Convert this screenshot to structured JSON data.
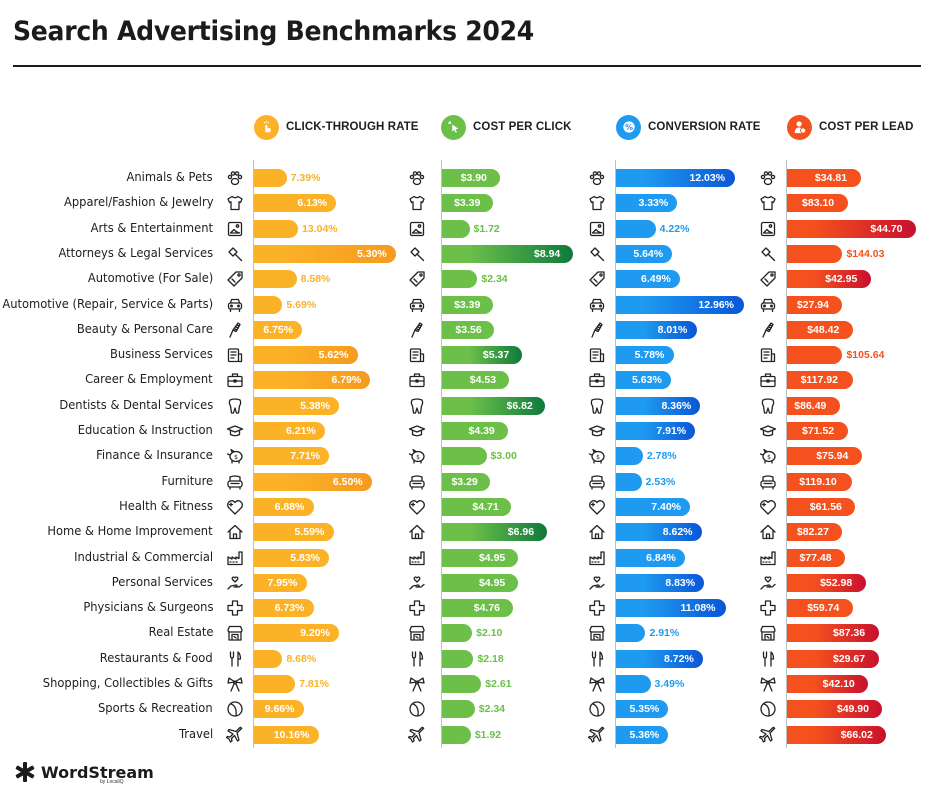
{
  "chart_data": {
    "type": "bar",
    "title": "Search Advertising Benchmarks 2024",
    "orientation": "horizontal",
    "categories": [
      "Animals & Pets",
      "Apparel/Fashion & Jewelry",
      "Arts & Entertainment",
      "Attorneys & Legal Services",
      "Automotive (For Sale)",
      "Automotive (Repair, Service & Parts)",
      "Beauty & Personal Care",
      "Business Services",
      "Career & Employment",
      "Dentists & Dental Services",
      "Education & Instruction",
      "Finance & Insurance",
      "Furniture",
      "Health & Fitness",
      "Home & Home Improvement",
      "Industrial & Commercial",
      "Personal Services",
      "Physicians & Surgeons",
      "Real Estate",
      "Restaurants & Food",
      "Shopping, Collectibles & Gifts",
      "Sports & Recreation",
      "Travel"
    ],
    "category_icons": [
      "paw-icon",
      "tshirt-icon",
      "picture-icon",
      "gavel-icon",
      "price-tag-icon",
      "car-icon",
      "comb-icon",
      "newspaper-icon",
      "briefcase-icon",
      "tooth-icon",
      "graduation-cap-icon",
      "piggy-bank-icon",
      "armchair-icon",
      "heart-icon",
      "house-icon",
      "factory-icon",
      "hand-heart-icon",
      "medical-cross-icon",
      "storefront-icon",
      "fork-knife-icon",
      "bow-icon",
      "ball-icon",
      "airplane-icon"
    ],
    "series": [
      {
        "name": "CLICK-THROUGH RATE",
        "icon": "tap-hand-icon",
        "color": "#FBB227",
        "color_end": "#F59A1F",
        "labels": [
          "7.39%",
          "6.13%",
          "13.04%",
          "5.30%",
          "8.58%",
          "5.69%",
          "6.75%",
          "5.62%",
          "6.79%",
          "5.38%",
          "6.21%",
          "7.71%",
          "6.50%",
          "6.88%",
          "5.59%",
          "5.83%",
          "7.95%",
          "6.73%",
          "9.20%",
          "8.68%",
          "7.81%",
          "9.66%",
          "10.16%"
        ],
        "values": [
          7.39,
          6.13,
          13.04,
          5.3,
          8.58,
          5.69,
          6.75,
          5.62,
          6.79,
          5.38,
          6.21,
          7.71,
          6.5,
          6.88,
          5.59,
          5.83,
          7.95,
          6.73,
          9.2,
          8.68,
          7.81,
          9.66,
          10.16
        ],
        "bar_fill_fraction": [
          0.23,
          0.58,
          0.31,
          1.0,
          0.3,
          0.2,
          0.34,
          0.73,
          0.82,
          0.6,
          0.5,
          0.53,
          0.83,
          0.42,
          0.56,
          0.53,
          0.37,
          0.42,
          0.6,
          0.2,
          0.29,
          0.35,
          0.46
        ]
      },
      {
        "name": "COST PER CLICK",
        "icon": "cursor-click-icon",
        "color": "#6CC04A",
        "color_end": "#0E7A3C",
        "labels": [
          "$3.90",
          "$3.39",
          "$1.72",
          "$8.94",
          "$2.34",
          "$3.39",
          "$3.56",
          "$5.37",
          "$4.53",
          "$6.82",
          "$4.39",
          "$3.00",
          "$3.29",
          "$4.71",
          "$6.96",
          "$4.95",
          "$4.95",
          "$4.76",
          "$2.10",
          "$2.18",
          "$2.61",
          "$2.34",
          "$1.92"
        ],
        "values": [
          3.9,
          3.39,
          1.72,
          8.94,
          2.34,
          3.39,
          3.56,
          5.37,
          4.53,
          6.82,
          4.39,
          3.0,
          3.29,
          4.71,
          6.96,
          4.95,
          4.95,
          4.76,
          2.1,
          2.18,
          2.61,
          2.34,
          1.92
        ],
        "bar_fill_fraction": [
          0.44,
          0.39,
          0.21,
          1.0,
          0.27,
          0.39,
          0.4,
          0.61,
          0.51,
          0.79,
          0.5,
          0.34,
          0.37,
          0.53,
          0.8,
          0.58,
          0.58,
          0.54,
          0.23,
          0.24,
          0.3,
          0.25,
          0.22
        ]
      },
      {
        "name": "CONVERSION RATE",
        "icon": "percent-icon",
        "color": "#1E9BF0",
        "color_end": "#0A56D6",
        "labels": [
          "12.03%",
          "3.33%",
          "4.22%",
          "5.64%",
          "6.49%",
          "12.96%",
          "8.01%",
          "5.78%",
          "5.63%",
          "8.36%",
          "7.91%",
          "2.78%",
          "2.53%",
          "7.40%",
          "8.62%",
          "6.84%",
          "8.83%",
          "11.08%",
          "2.91%",
          "8.72%",
          "3.49%",
          "5.35%",
          "5.36%"
        ],
        "values": [
          12.03,
          3.33,
          4.22,
          5.64,
          6.49,
          12.96,
          8.01,
          5.78,
          5.63,
          8.36,
          7.91,
          2.78,
          2.53,
          7.4,
          8.62,
          6.84,
          8.83,
          11.08,
          2.91,
          8.72,
          3.49,
          5.35,
          5.36
        ],
        "bar_fill_fraction": [
          0.93,
          0.48,
          0.31,
          0.44,
          0.5,
          1.0,
          0.63,
          0.45,
          0.43,
          0.66,
          0.62,
          0.21,
          0.2,
          0.58,
          0.67,
          0.54,
          0.69,
          0.86,
          0.23,
          0.68,
          0.27,
          0.41,
          0.41
        ]
      },
      {
        "name": "COST PER LEAD",
        "icon": "person-dollar-icon",
        "color": "#F4511E",
        "color_end": "#C8102E",
        "labels": [
          "$34.81",
          "$83.10",
          "$44.70",
          "$144.03",
          "$42.95",
          "$27.94",
          "$48.42",
          "$105.64",
          "$117.92",
          "$86.49",
          "$71.52",
          "$75.94",
          "$119.10",
          "$61.56",
          "$82.27",
          "$77.48",
          "$52.98",
          "$59.74",
          "$87.36",
          "$29.67",
          "$42.10",
          "$49.90",
          "$66.02"
        ],
        "values": [
          34.81,
          83.1,
          44.7,
          144.03,
          42.95,
          27.94,
          48.42,
          105.64,
          117.92,
          86.49,
          71.52,
          75.94,
          119.1,
          61.56,
          82.27,
          77.48,
          52.98,
          59.74,
          87.36,
          29.67,
          42.1,
          49.9,
          66.02
        ],
        "bar_fill_fraction": [
          0.57,
          0.47,
          1.0,
          0.43,
          0.65,
          0.43,
          0.51,
          0.43,
          0.51,
          0.41,
          0.47,
          0.58,
          0.5,
          0.53,
          0.43,
          0.45,
          0.61,
          0.51,
          0.71,
          0.71,
          0.63,
          0.74,
          0.77
        ]
      }
    ],
    "xlabel": "",
    "ylabel": "",
    "grid": false,
    "legend": "top"
  },
  "footer": {
    "brand": "WordStream",
    "byline": "by LocaliQ"
  }
}
